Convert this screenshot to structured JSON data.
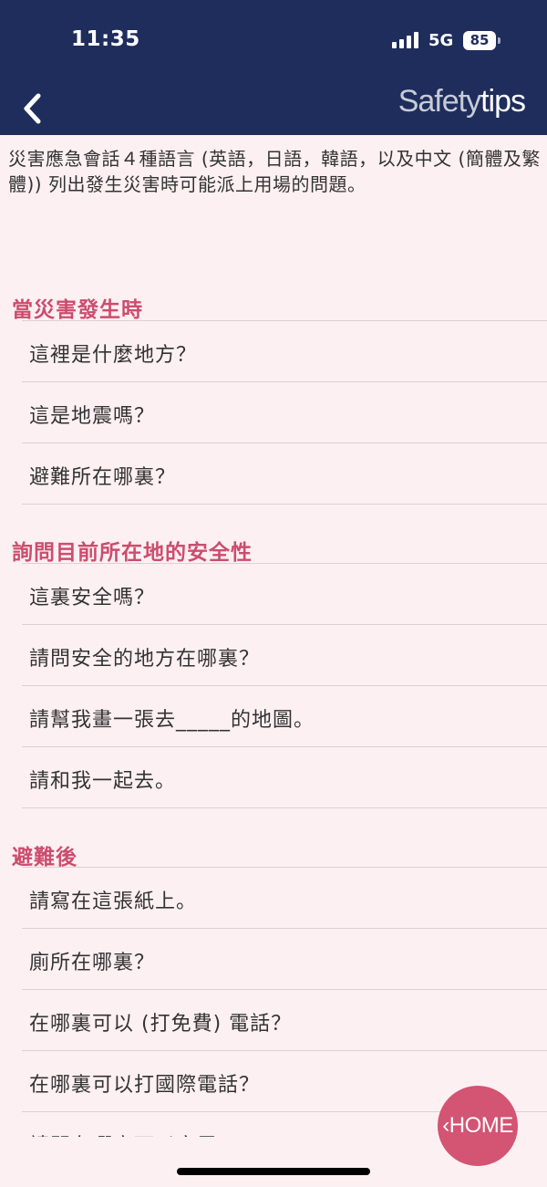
{
  "status_bar": {
    "time": "11:35",
    "network": "5G",
    "battery": "85"
  },
  "nav": {
    "title_part1": "Safety",
    "title_part2": "tips",
    "back_icon": "chevron-left-icon"
  },
  "intro": "災害應急會話４種語言 (英語，日語，韓語，以及中文 (簡體及繁體)) 列出發生災害時可能派上用場的問題。",
  "sections": [
    {
      "title": "當災害發生時",
      "items": [
        "這裡是什麼地方？",
        "這是地震嗎？",
        "避難所在哪裏？"
      ]
    },
    {
      "title": "詢問目前所在地的安全性",
      "items": [
        "這裏安全嗎？",
        "請問安全的地方在哪裏？",
        "請幫我畫一張去_____的地圖。",
        "請和我一起去。"
      ]
    },
    {
      "title": "避難後",
      "items": [
        "請寫在這張紙上。",
        "廁所在哪裏？",
        "在哪裏可以 (打免費) 電話？",
        "在哪裏可以打國際電話？",
        "請問在哪裏可以充電？"
      ]
    }
  ],
  "home_button": "HOME",
  "colors": {
    "header_bg": "#1e2d5c",
    "accent": "#cc4d6e",
    "home_bg": "#d35473",
    "page_bg": "#fdf0f3"
  }
}
